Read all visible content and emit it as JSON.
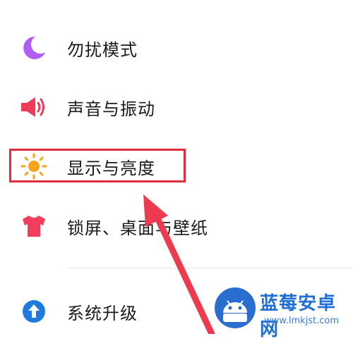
{
  "menu": {
    "items": [
      {
        "label": "勿扰模式",
        "icon": "moon-icon",
        "color": "#b15cf5"
      },
      {
        "label": "声音与振动",
        "icon": "speaker-icon",
        "color": "#ee3a5a"
      },
      {
        "label": "显示与亮度",
        "icon": "sun-icon",
        "color": "#f7a21b"
      },
      {
        "label": "锁屏、桌面与壁纸",
        "icon": "tshirt-icon",
        "color": "#f23d5c"
      },
      {
        "label": "系统升级",
        "icon": "upgrade-arrow-icon",
        "color": "#1f7ae0"
      }
    ]
  },
  "annotation": {
    "highlight_color": "#e02c3c",
    "arrow_color": "#ec3a4e"
  },
  "watermark": {
    "brand": "蓝莓安卓网",
    "url": "www.lmkjst.com"
  }
}
